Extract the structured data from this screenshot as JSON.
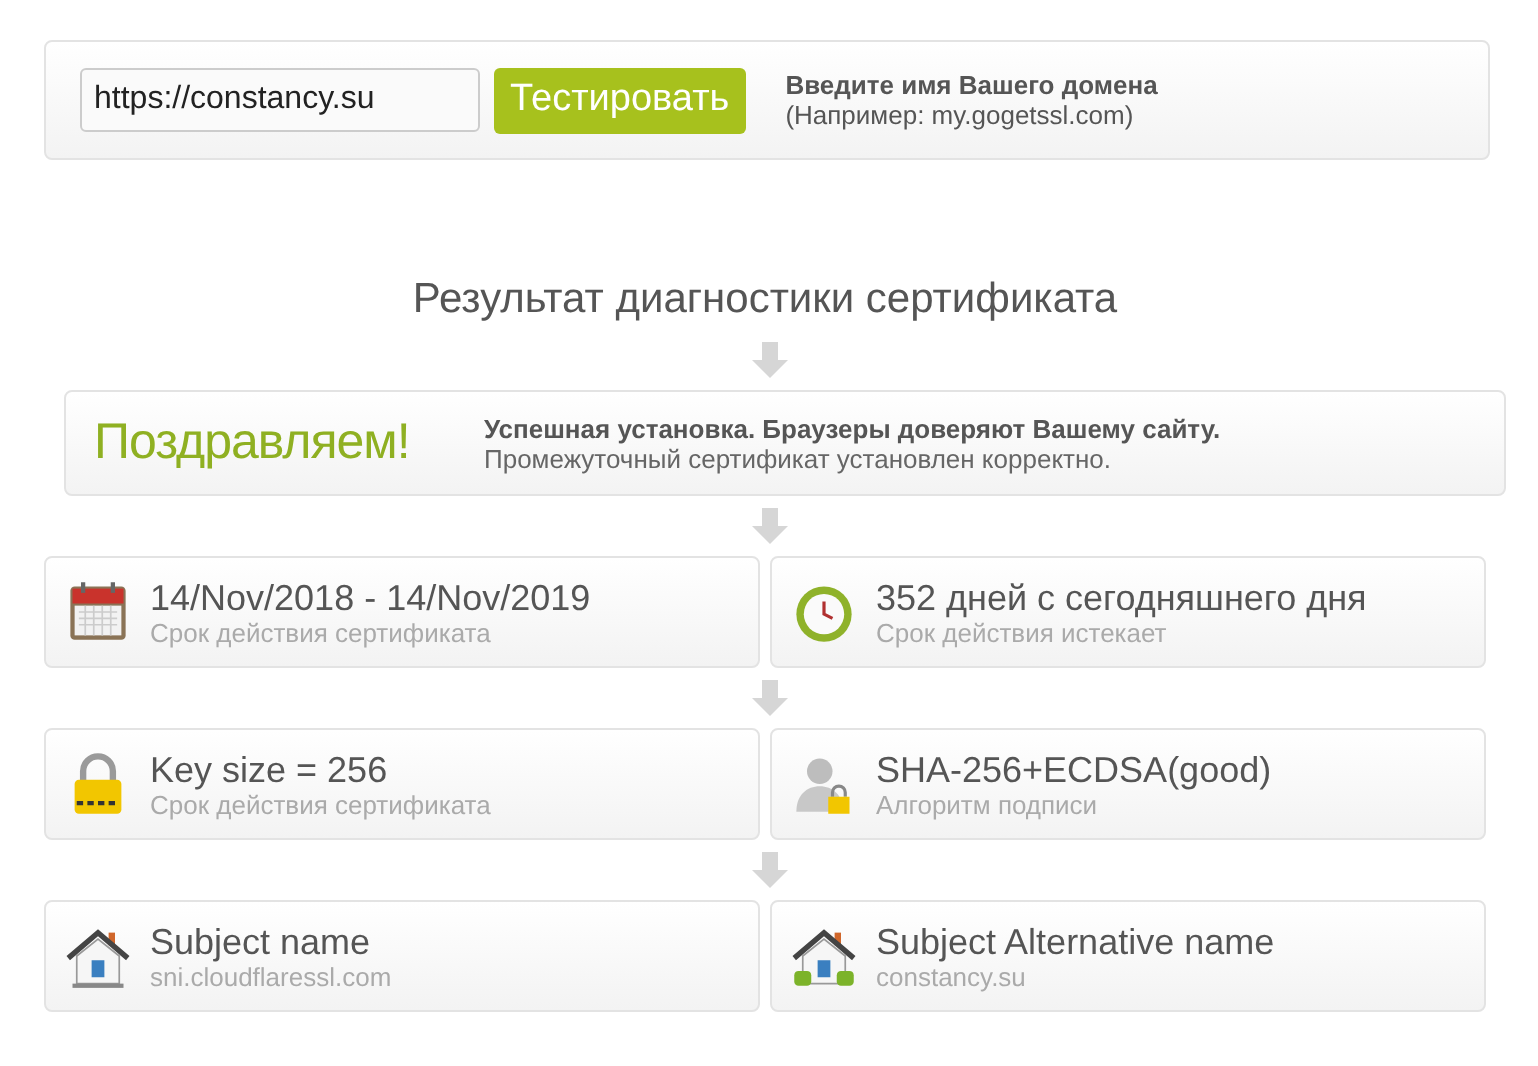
{
  "domain_form": {
    "value": "https://constancy.su",
    "button": "Тестировать",
    "hint_title": "Введите имя Вашего домена",
    "hint_example": "(Например: my.gogetssl.com)"
  },
  "heading": "Результат диагностики сертификата",
  "congrats": {
    "title": "Поздравляем!",
    "line_1": "Успешная установка. Браузеры доверяют Вашему сайту.",
    "line_2": "Промежуточный сертификат установлен корректно."
  },
  "rows": [
    [
      {
        "kind": "calendar",
        "value": "14/Nov/2018 - 14/Nov/2019",
        "label": "Срок действия сертификата"
      },
      {
        "kind": "clock",
        "value": "352 дней с сегодняшнего дня",
        "label": "Срок действия истекает"
      }
    ],
    [
      {
        "kind": "lock",
        "value": "Key size = 256",
        "label": "Срок действия сертификата"
      },
      {
        "kind": "user",
        "value": "SHA-256+ECDSA(good)",
        "label": "Алгоритм подписи"
      }
    ],
    [
      {
        "kind": "house",
        "value": "Subject name",
        "label": "sni.cloudflaressl.com"
      },
      {
        "kind": "house-green",
        "value": "Subject Alternative name",
        "label": "constancy.su"
      }
    ]
  ]
}
